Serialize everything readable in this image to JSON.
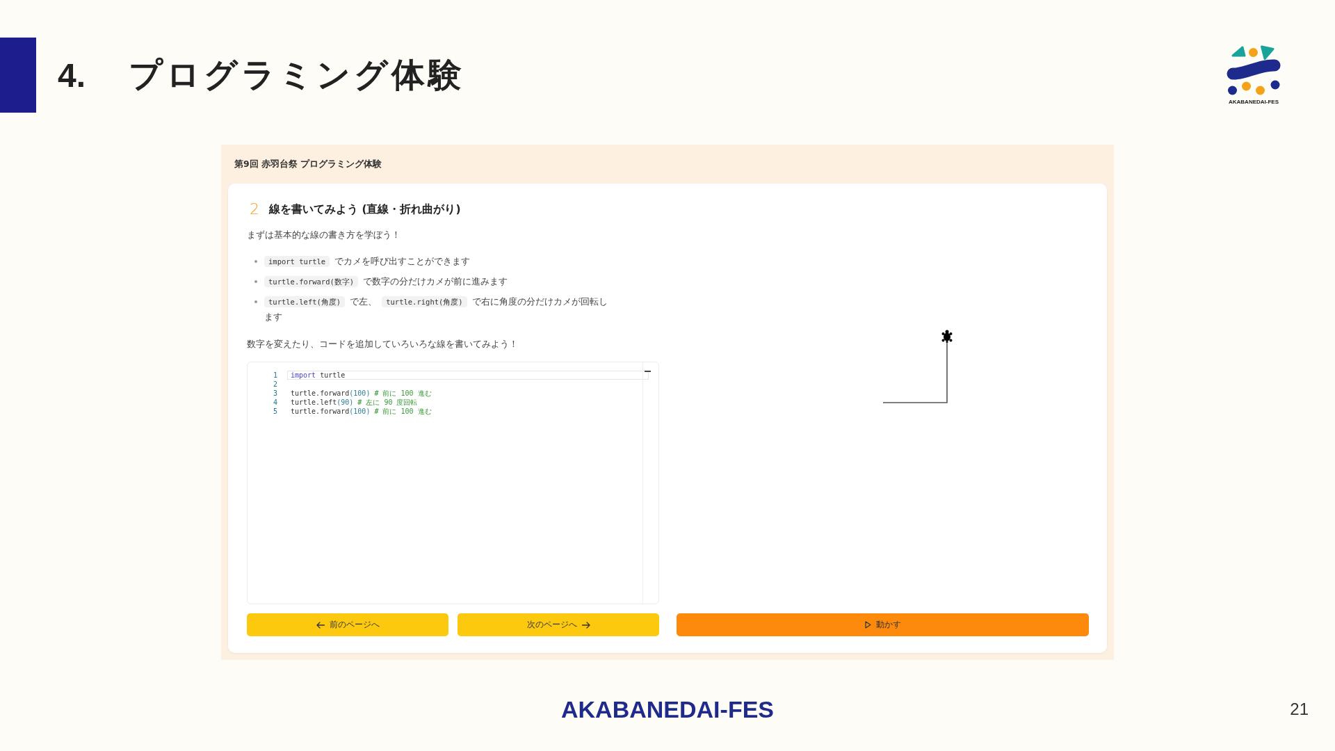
{
  "slide": {
    "section_number": "4.",
    "title": "プログラミング体験",
    "logo_text": "AKABANEDAI-FES",
    "footer": "AKABANEDAI-FES",
    "page_number": "21"
  },
  "app": {
    "header": "第9回 赤羽台祭 プログラミング体験",
    "step_number": "2",
    "heading": "線を書いてみよう (直線・折れ曲がり)",
    "intro": "まずは基本的な線の書き方を学ぼう！",
    "bullets": [
      {
        "parts": [
          {
            "kind": "code",
            "text": "import turtle"
          },
          {
            "kind": "text",
            "text": "でカメを呼び出すことができます"
          }
        ]
      },
      {
        "parts": [
          {
            "kind": "code",
            "text": "turtle.forward(数字)"
          },
          {
            "kind": "text",
            "text": "で数字の分だけカメが前に進みます"
          }
        ]
      },
      {
        "parts": [
          {
            "kind": "code",
            "text": "turtle.left(角度)"
          },
          {
            "kind": "text",
            "text": "で左、"
          },
          {
            "kind": "code",
            "text": "turtle.right(角度)"
          },
          {
            "kind": "text",
            "text": "で右に角度の分だけカメが回転します"
          }
        ]
      }
    ],
    "prompt": "数字を変えたり、コードを追加していろいろな線を書いてみよう！",
    "editor": {
      "lines": [
        {
          "number": "1",
          "active": true,
          "tokens": [
            {
              "kind": "keyword",
              "text": "import"
            },
            {
              "kind": "plain",
              "text": " turtle"
            }
          ]
        },
        {
          "number": "2",
          "active": false
        },
        {
          "number": "3",
          "active": false,
          "tokens": [
            {
              "kind": "plain",
              "text": "turtle.forward"
            },
            {
              "kind": "number",
              "text": "(100)"
            },
            {
              "kind": "comment",
              "text": " # 前に 100 進む"
            }
          ]
        },
        {
          "number": "4",
          "active": false,
          "tokens": [
            {
              "kind": "plain",
              "text": "turtle.left"
            },
            {
              "kind": "number",
              "text": "(90)"
            },
            {
              "kind": "comment",
              "text": " # 左に 90 度回転"
            }
          ]
        },
        {
          "number": "5",
          "active": false,
          "tokens": [
            {
              "kind": "plain",
              "text": "turtle.forward"
            },
            {
              "kind": "number",
              "text": "(100)"
            },
            {
              "kind": "comment",
              "text": " # 前に 100 進む"
            }
          ]
        }
      ]
    },
    "buttons": [
      {
        "kind": "back",
        "label": "前のページへ"
      },
      {
        "kind": "next",
        "label": "次のページへ"
      },
      {
        "kind": "run",
        "label": "動かす"
      }
    ]
  }
}
